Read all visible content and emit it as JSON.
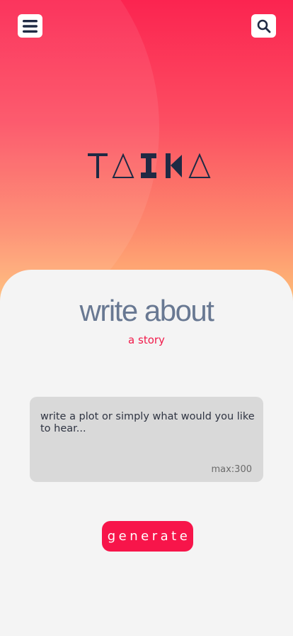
{
  "header": {
    "menu_icon": "hamburger-menu-icon",
    "search_icon": "search-icon"
  },
  "brand": {
    "logo_text": "TAIKA",
    "logo_color": "#1f2a44"
  },
  "main": {
    "title": "write about",
    "subtitle": "a story"
  },
  "plot_input": {
    "value": "",
    "placeholder": "write a plot or simply what would you like to hear...",
    "max_label": "max:300"
  },
  "actions": {
    "generate_label": "generate"
  },
  "colors": {
    "accent": "#f7154a",
    "title": "#687892",
    "gradient_top": "#fb2450",
    "gradient_bottom": "#ffc079"
  }
}
